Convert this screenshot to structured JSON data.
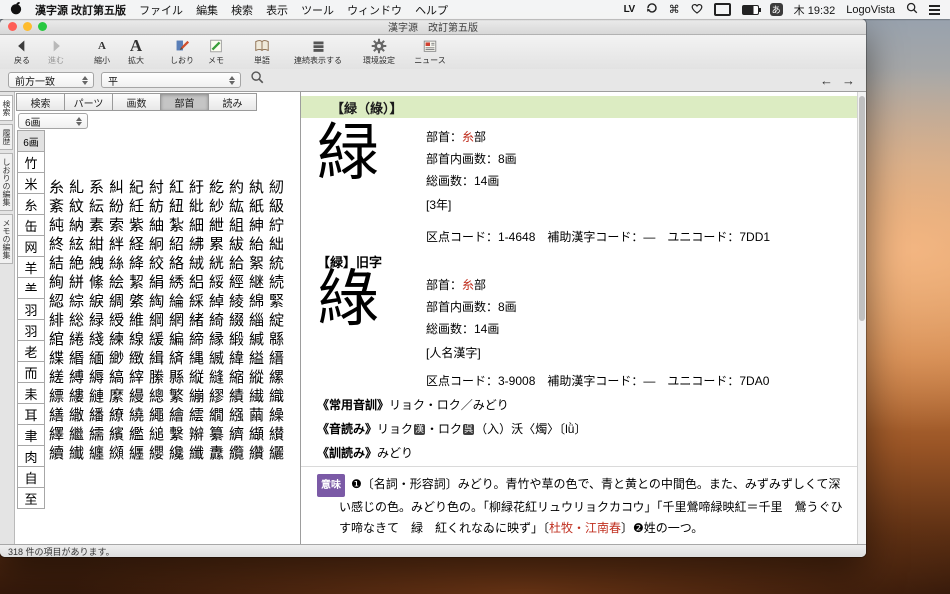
{
  "colors": {
    "band_green": "#dcecc2",
    "meaning_badge_purple": "#7b5aa6",
    "link_red": "#c03020"
  },
  "menu_bar": {
    "app_name": "漢字源 改訂第五版",
    "items": [
      "ファイル",
      "編集",
      "検索",
      "表示",
      "ツール",
      "ウィンドウ",
      "ヘルプ"
    ],
    "status": {
      "lv": "LV",
      "ime": "あ",
      "clock": "木 19:32",
      "brand": "LogoVista"
    }
  },
  "window": {
    "title": "漢字源　改訂第五版",
    "toolbar": {
      "back": "戻る",
      "forward": "進む",
      "zoom_out": "縮小",
      "zoom_in": "拡大",
      "bookmark": "しおり",
      "memo": "メモ",
      "word": "単語",
      "continuous": "連続表示する",
      "prefs": "環境設定",
      "news": "ニュース"
    },
    "toolbar_icons": {
      "small_a": "A",
      "large_a": "A"
    },
    "search": {
      "mode": "前方一致",
      "query": "平"
    },
    "nav": {
      "prev": "←",
      "next": "→"
    },
    "side_tabs": [
      "検索",
      "履歴",
      "しおりの編集",
      "メモの編集"
    ],
    "tabs": [
      "検索",
      "パーツ",
      "画数",
      "部首",
      "読み"
    ],
    "active_tab": "部首",
    "stroke_popup": "6画",
    "radical_header": "6画",
    "radicals": [
      "竹",
      "米",
      "糸",
      "缶",
      "网",
      "羊",
      "⺷",
      "羽",
      "羽",
      "老",
      "而",
      "耒",
      "耳",
      "聿",
      "肉",
      "自",
      "至"
    ],
    "kanji_rows": [
      "糸糺系糾紀紂紅紆紇約紈紉",
      "紊紋紜紛紝紡紐紕紗紘紙級",
      "純納素索紫紬紮細紲組紳紵",
      "終絃紺絆経絅紹紼累紱紿絀",
      "結絶絏絲絳絞絡絨絖給絮統",
      "絢絣絛絵絜絹綉絽綏經継続",
      "綛綜綟綢綮綯綸綵綽綾綿緊",
      "緋総緑綬維綱網緒綺綴緇綻",
      "綰綣綫練線緩編締縁緞緘緜",
      "緤緡緬緲緻緝緕縄縅緯縊縉",
      "縒縛縟縞縡縢縣縦縫縮縱縲",
      "縹縷縺縻縵總繁繃繆績繊織",
      "繕繖繙繚繞繩繪繧繝繦繭繰",
      "繹繼繻繽繿縋繫辮纂纃纈纉",
      "續纎纏纐纒纓纔纖纛纜纘纚"
    ],
    "status_text": "318 件の項目があります。"
  },
  "entry": {
    "header": "【緑（綠）】",
    "block1": {
      "glyph": "緑",
      "radical_label": "部首：",
      "radical_link": "糸",
      "radical_suffix": "部",
      "strokes_in": "部首内画数：8画",
      "strokes_total": "総画数：14画",
      "grade": "[3年]",
      "codes": "区点コード：1-4648　補助漢字コード：―　ユニコード：7DD1"
    },
    "block2": {
      "title": "【緑】旧字",
      "glyph": "綠",
      "radical_label": "部首：",
      "radical_link": "糸",
      "radical_suffix": "部",
      "strokes_in": "部首内画数：8画",
      "strokes_total": "総画数：14画",
      "grade": "[人名漢字]",
      "codes": "区点コード：3-9008　補助漢字コード：―　ユニコード：7DA0"
    },
    "joyo": {
      "head": "《常用音訓》",
      "body": "リョク・ロク／みどり"
    },
    "on": {
      "head": "《音読み》",
      "p1": "リョク",
      "b1": "漢",
      "p2": "・ロク",
      "b2": "呉",
      "tail": "（入）沃〈燭〉〔lǜ〕"
    },
    "kun": {
      "head": "《訓読み》",
      "body": "みどり"
    },
    "meaning": {
      "badge": "意味",
      "t1": "❶〔名詞・形容詞〕みどり。青竹や草の色で、青と黄との中間色。また、みずみずしくて深い感じの色。みどり色の。「柳緑花紅リュウリョクカコウ」「千里鶯啼緑映紅＝千里　鶯うぐひす啼なきて　緑　紅くれなゐに映ず」〔",
      "link": "杜牧・江南春",
      "t2": "〕❷姓の一つ。"
    }
  }
}
